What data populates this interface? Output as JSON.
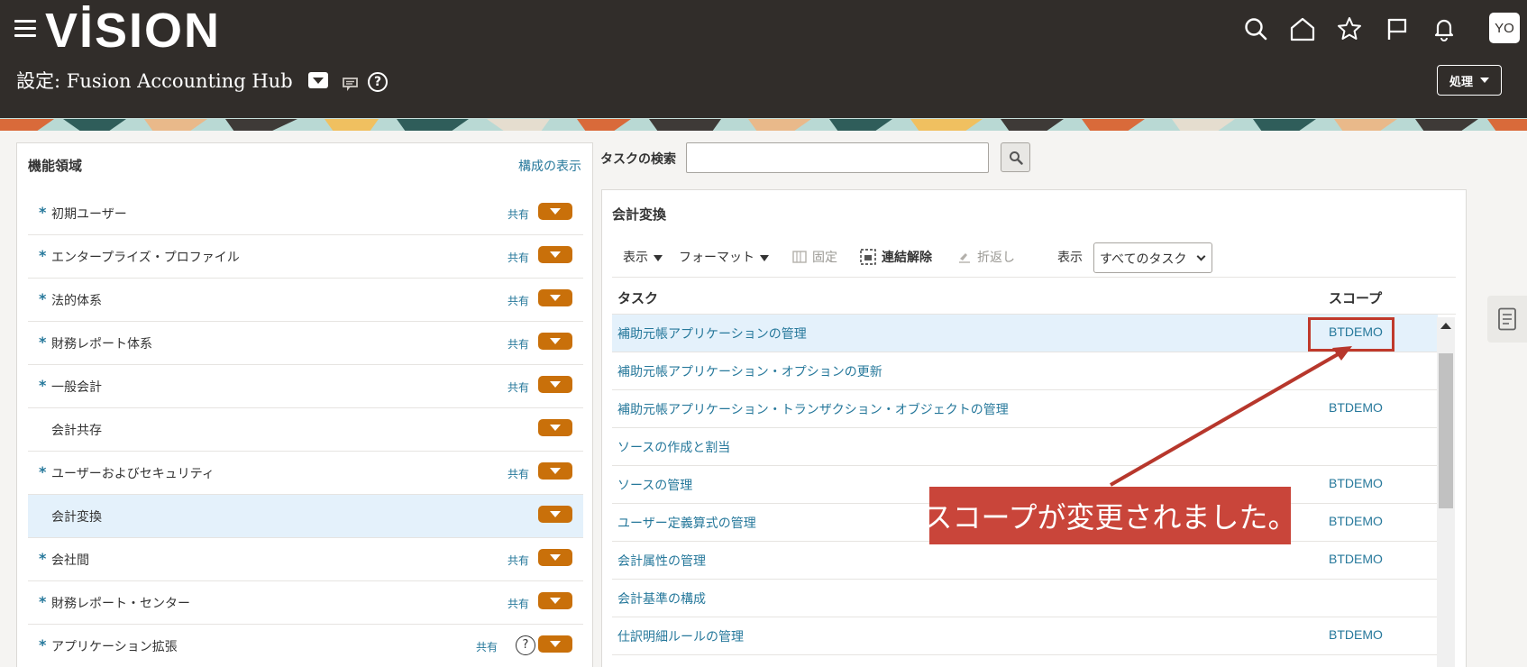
{
  "header": {
    "logo": "VİSION",
    "title": "設定: Fusion Accounting Hub",
    "actions_label": "処理",
    "avatar_initials": "YO"
  },
  "left_panel": {
    "title": "機能領域",
    "link": "構成の表示",
    "items": [
      {
        "label": "初期ユーザー",
        "required": true,
        "shared": "共有",
        "selected": false
      },
      {
        "label": "エンタープライズ・プロファイル",
        "required": true,
        "shared": "共有",
        "selected": false
      },
      {
        "label": "法的体系",
        "required": true,
        "shared": "共有",
        "selected": false
      },
      {
        "label": "財務レポート体系",
        "required": true,
        "shared": "共有",
        "selected": false
      },
      {
        "label": "一般会計",
        "required": true,
        "shared": "共有",
        "selected": false
      },
      {
        "label": "会計共存",
        "required": false,
        "shared": "",
        "selected": false
      },
      {
        "label": "ユーザーおよびセキュリティ",
        "required": true,
        "shared": "共有",
        "selected": false
      },
      {
        "label": "会計変換",
        "required": false,
        "shared": "",
        "selected": true
      },
      {
        "label": "会社間",
        "required": true,
        "shared": "共有",
        "selected": false
      },
      {
        "label": "財務レポート・センター",
        "required": true,
        "shared": "共有",
        "selected": false
      },
      {
        "label": "アプリケーション拡張",
        "required": true,
        "shared": "共有",
        "selected": false,
        "help": true
      }
    ],
    "required_marker": "*",
    "help_glyph": "?"
  },
  "search": {
    "label": "タスクの検索",
    "value": "",
    "placeholder": ""
  },
  "right_panel": {
    "title": "会計変換",
    "toolbar": {
      "view": "表示",
      "format": "フォーマット",
      "freeze": "固定",
      "detach": "連結解除",
      "wrap": "折返し",
      "show_label": "表示",
      "show_value": "すべてのタスク"
    },
    "columns": {
      "task": "タスク",
      "scope": "スコープ"
    },
    "rows": [
      {
        "task": "補助元帳アプリケーションの管理",
        "scope": "BTDEMO",
        "selected": true
      },
      {
        "task": "補助元帳アプリケーション・オプションの更新",
        "scope": ""
      },
      {
        "task": "補助元帳アプリケーション・トランザクション・オブジェクトの管理",
        "scope": "BTDEMO"
      },
      {
        "task": "ソースの作成と割当",
        "scope": ""
      },
      {
        "task": "ソースの管理",
        "scope": "BTDEMO"
      },
      {
        "task": "ユーザー定義算式の管理",
        "scope": "BTDEMO"
      },
      {
        "task": "会計属性の管理",
        "scope": "BTDEMO"
      },
      {
        "task": "会計基準の構成",
        "scope": ""
      },
      {
        "task": "仕訳明細ルールの管理",
        "scope": "BTDEMO"
      }
    ]
  },
  "callout": {
    "text": "スコープが変更されました。",
    "color": "#c9453a"
  },
  "colors": {
    "header_bg": "#312d2a",
    "link": "#26789b",
    "orange": "#c9700a",
    "selected_row": "#e4f1fb"
  }
}
